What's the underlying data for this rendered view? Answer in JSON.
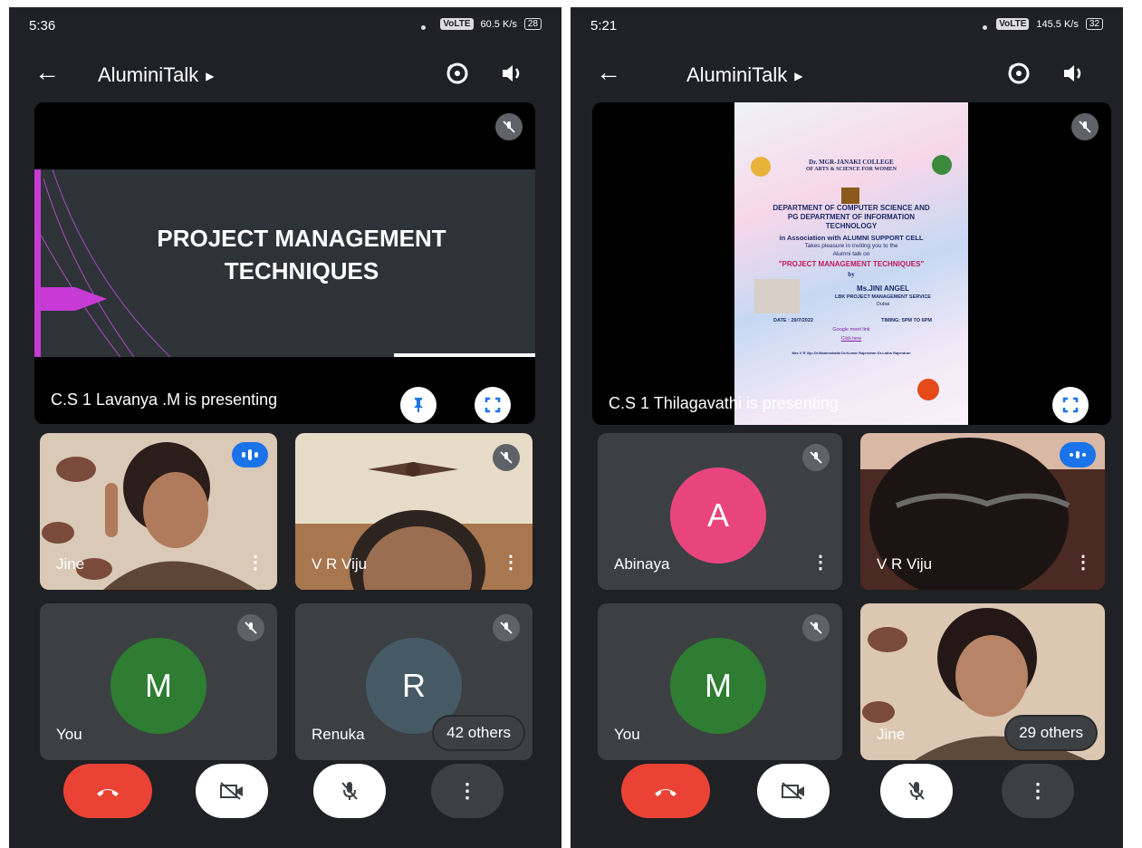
{
  "left": {
    "status": {
      "time": "5:36",
      "network": "VoLTE",
      "speed": "60.5 K/s",
      "battery": "28"
    },
    "header": {
      "title": "AluminiTalk"
    },
    "presentation": {
      "slide_title": "PROJECT MANAGEMENT\nTECHNIQUES",
      "label": "C.S 1 Lavanya .M is presenting"
    },
    "tiles": [
      {
        "name": "Jine"
      },
      {
        "name": "V R Viju"
      },
      {
        "name": "You",
        "initial": "M"
      },
      {
        "name": "Renuka",
        "initial": "R",
        "others": "42 others"
      }
    ]
  },
  "right": {
    "status": {
      "time": "5:21",
      "network": "VoLTE",
      "speed": "145.5 K/s",
      "battery": "32"
    },
    "header": {
      "title": "AluminiTalk"
    },
    "presentation": {
      "label": "C.S 1 Thilagavathi is presenting",
      "poster": {
        "college_line1": "Dr. MGR-JANAKI COLLEGE",
        "college_line2": "OF ARTS & SCIENCE FOR WOMEN",
        "dept_line1": "DEPARTMENT OF COMPUTER SCIENCE AND",
        "dept_line2": "PG DEPARTMENT OF INFORMATION",
        "dept_line3": "TECHNOLOGY",
        "assoc": "in Association with ALUMNI SUPPORT CELL",
        "invite1": "Takes pleasure in inviting you to the",
        "invite2": "Alumni talk on",
        "talk": "\"PROJECT MANAGEMENT TECHNIQUES\"",
        "by": "by",
        "speaker": "Ms.JINI ANGEL",
        "company": "LBK PROJECT MANAGEMENT SERVICE",
        "city": "Dubai",
        "date": "DATE : 29/7/2022",
        "timing": "TIMING: 5PM TO 6PM",
        "link1": "Google meet link",
        "link2": "Click here",
        "footer": "Mrs V R Viju   Dr.Manimekalai   Dr.Kumar Rajendran   Dr.Latha Rajendran"
      }
    },
    "tiles": [
      {
        "name": "Abinaya",
        "initial": "A"
      },
      {
        "name": "V R Viju"
      },
      {
        "name": "You",
        "initial": "M"
      },
      {
        "name": "Jine",
        "others": "29 others"
      }
    ]
  },
  "colors": {
    "bg": "#202124",
    "tile": "#3c4043",
    "end_call": "#ea4335",
    "accent": "#1a73e8",
    "avatar_m": "#2e7d32",
    "avatar_r": "#455a64",
    "avatar_a": "#e8457c"
  }
}
